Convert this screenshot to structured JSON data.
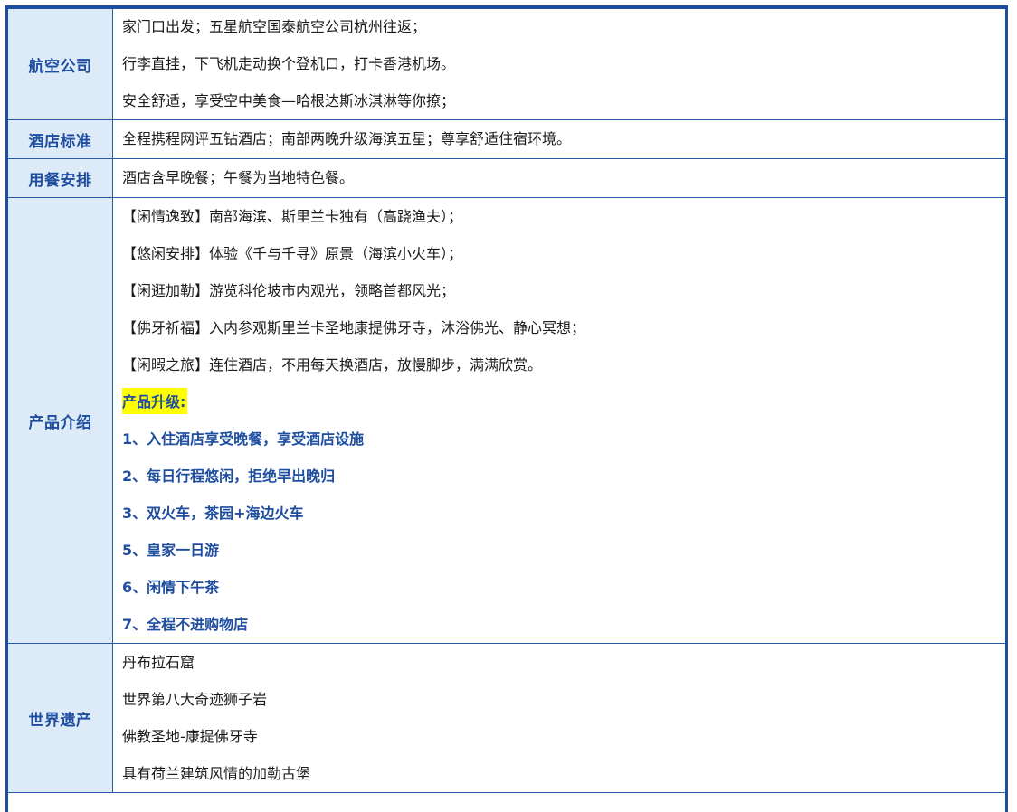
{
  "rows": [
    {
      "label": "航空公司",
      "lines": [
        "家门口出发；五星航空国泰航空公司杭州往返；",
        "行李直挂，下飞机走动换个登机口，打卡香港机场。",
        "安全舒适，享受空中美食—哈根达斯冰淇淋等你撩；"
      ]
    },
    {
      "label": "酒店标准",
      "lines": [
        "全程携程网评五钻酒店；南部两晚升级海滨五星；尊享舒适住宿环境。"
      ]
    },
    {
      "label": "用餐安排",
      "lines": [
        "酒店含早晚餐；午餐为当地特色餐。"
      ]
    },
    {
      "label": "产品介绍",
      "lines": [
        "【闲情逸致】南部海滨、斯里兰卡独有（高跷渔夫）；",
        "【悠闲安排】体验《千与千寻》原景（海滨小火车）；",
        "【闲逛加勒】游览科伦坡市内观光，领略首都风光；",
        "【佛牙祈福】入内参观斯里兰卡圣地康提佛牙寺，沐浴佛光、静心冥想；",
        "【闲暇之旅】连住酒店，不用每天换酒店，放慢脚步，满满欣赏。"
      ],
      "upgrade_title": "产品升级:",
      "upgrades": [
        "1、入住酒店享受晚餐，享受酒店设施",
        "2、每日行程悠闲，拒绝早出晚归",
        "3、双火车，茶园+海边火车",
        "5、皇家一日游",
        "6、闲情下午茶",
        "7、全程不进购物店"
      ]
    },
    {
      "label": "世界遗产",
      "lines": [
        "丹布拉石窟",
        "世界第八大奇迹狮子岩",
        "佛教圣地-康提佛牙寺",
        "具有荷兰建筑风情的加勒古堡"
      ]
    }
  ],
  "colors": {
    "border": "#1f4ea0",
    "label_bg": "#ddebf8",
    "label_text": "#1f4ea0",
    "highlight": "#ffff00"
  }
}
